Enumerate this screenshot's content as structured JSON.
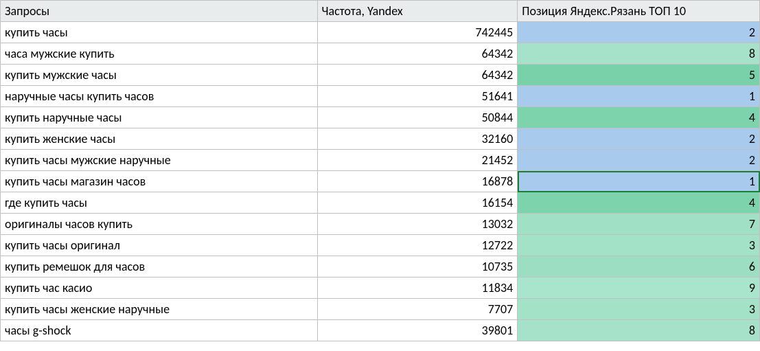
{
  "headers": {
    "query": "Запросы",
    "freq": "Частота, Yandex",
    "pos": "Позиция Яндекс.Рязань ТОП 10"
  },
  "position_colors": {
    "1": "#a8cbed",
    "2": "#a7caed",
    "3": "#a4e2c8",
    "4": "#7dd3ac",
    "5": "#78d1a8",
    "6": "#9cdec1",
    "7": "#a0e0c5",
    "8": "#a5e2c9",
    "9": "#a9e4cc"
  },
  "rows": [
    {
      "query": "купить часы",
      "freq": "742445",
      "pos": "2",
      "selected": false
    },
    {
      "query": "часа мужские купить",
      "freq": "64342",
      "pos": "8",
      "selected": false
    },
    {
      "query": "купить мужские часы",
      "freq": "64342",
      "pos": "5",
      "selected": false
    },
    {
      "query": "наручные часы купить часов",
      "freq": "51641",
      "pos": "1",
      "selected": false
    },
    {
      "query": "купить наручные часы",
      "freq": "50844",
      "pos": "4",
      "selected": false
    },
    {
      "query": "купить женские часы",
      "freq": "32160",
      "pos": "2",
      "selected": false
    },
    {
      "query": "купить часы мужские наручные",
      "freq": "21452",
      "pos": "2",
      "selected": false
    },
    {
      "query": "купить часы магазин часов",
      "freq": "16878",
      "pos": "1",
      "selected": true
    },
    {
      "query": "где купить часы",
      "freq": "16154",
      "pos": "4",
      "selected": false
    },
    {
      "query": "оригиналы часов купить",
      "freq": "13032",
      "pos": "7",
      "selected": false
    },
    {
      "query": "купить часы оригинал",
      "freq": "12722",
      "pos": "3",
      "selected": false
    },
    {
      "query": "купить ремешок для часов",
      "freq": "10735",
      "pos": "6",
      "selected": false
    },
    {
      "query": "купить час касио",
      "freq": "11834",
      "pos": "9",
      "selected": false
    },
    {
      "query": "купить часы женские наручные",
      "freq": "7707",
      "pos": "3",
      "selected": false
    },
    {
      "query": "часы g-shock",
      "freq": "39801",
      "pos": "8",
      "selected": false
    }
  ]
}
